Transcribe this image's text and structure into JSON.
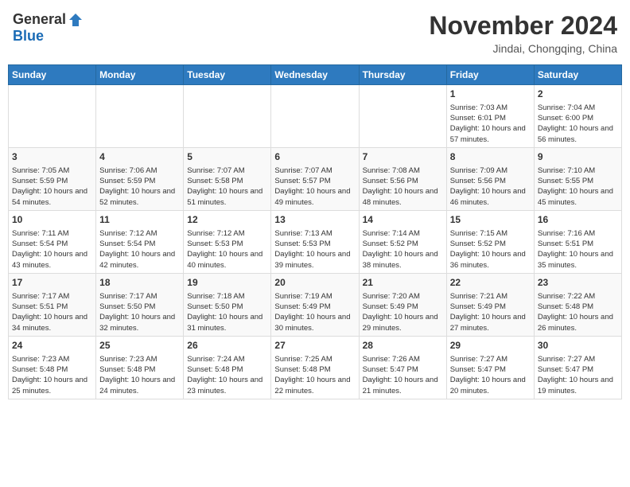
{
  "header": {
    "logo_general": "General",
    "logo_blue": "Blue",
    "month_title": "November 2024",
    "subtitle": "Jindai, Chongqing, China"
  },
  "calendar": {
    "days_of_week": [
      "Sunday",
      "Monday",
      "Tuesday",
      "Wednesday",
      "Thursday",
      "Friday",
      "Saturday"
    ],
    "weeks": [
      [
        {
          "day": "",
          "info": ""
        },
        {
          "day": "",
          "info": ""
        },
        {
          "day": "",
          "info": ""
        },
        {
          "day": "",
          "info": ""
        },
        {
          "day": "",
          "info": ""
        },
        {
          "day": "1",
          "info": "Sunrise: 7:03 AM\nSunset: 6:01 PM\nDaylight: 10 hours and 57 minutes."
        },
        {
          "day": "2",
          "info": "Sunrise: 7:04 AM\nSunset: 6:00 PM\nDaylight: 10 hours and 56 minutes."
        }
      ],
      [
        {
          "day": "3",
          "info": "Sunrise: 7:05 AM\nSunset: 5:59 PM\nDaylight: 10 hours and 54 minutes."
        },
        {
          "day": "4",
          "info": "Sunrise: 7:06 AM\nSunset: 5:59 PM\nDaylight: 10 hours and 52 minutes."
        },
        {
          "day": "5",
          "info": "Sunrise: 7:07 AM\nSunset: 5:58 PM\nDaylight: 10 hours and 51 minutes."
        },
        {
          "day": "6",
          "info": "Sunrise: 7:07 AM\nSunset: 5:57 PM\nDaylight: 10 hours and 49 minutes."
        },
        {
          "day": "7",
          "info": "Sunrise: 7:08 AM\nSunset: 5:56 PM\nDaylight: 10 hours and 48 minutes."
        },
        {
          "day": "8",
          "info": "Sunrise: 7:09 AM\nSunset: 5:56 PM\nDaylight: 10 hours and 46 minutes."
        },
        {
          "day": "9",
          "info": "Sunrise: 7:10 AM\nSunset: 5:55 PM\nDaylight: 10 hours and 45 minutes."
        }
      ],
      [
        {
          "day": "10",
          "info": "Sunrise: 7:11 AM\nSunset: 5:54 PM\nDaylight: 10 hours and 43 minutes."
        },
        {
          "day": "11",
          "info": "Sunrise: 7:12 AM\nSunset: 5:54 PM\nDaylight: 10 hours and 42 minutes."
        },
        {
          "day": "12",
          "info": "Sunrise: 7:12 AM\nSunset: 5:53 PM\nDaylight: 10 hours and 40 minutes."
        },
        {
          "day": "13",
          "info": "Sunrise: 7:13 AM\nSunset: 5:53 PM\nDaylight: 10 hours and 39 minutes."
        },
        {
          "day": "14",
          "info": "Sunrise: 7:14 AM\nSunset: 5:52 PM\nDaylight: 10 hours and 38 minutes."
        },
        {
          "day": "15",
          "info": "Sunrise: 7:15 AM\nSunset: 5:52 PM\nDaylight: 10 hours and 36 minutes."
        },
        {
          "day": "16",
          "info": "Sunrise: 7:16 AM\nSunset: 5:51 PM\nDaylight: 10 hours and 35 minutes."
        }
      ],
      [
        {
          "day": "17",
          "info": "Sunrise: 7:17 AM\nSunset: 5:51 PM\nDaylight: 10 hours and 34 minutes."
        },
        {
          "day": "18",
          "info": "Sunrise: 7:17 AM\nSunset: 5:50 PM\nDaylight: 10 hours and 32 minutes."
        },
        {
          "day": "19",
          "info": "Sunrise: 7:18 AM\nSunset: 5:50 PM\nDaylight: 10 hours and 31 minutes."
        },
        {
          "day": "20",
          "info": "Sunrise: 7:19 AM\nSunset: 5:49 PM\nDaylight: 10 hours and 30 minutes."
        },
        {
          "day": "21",
          "info": "Sunrise: 7:20 AM\nSunset: 5:49 PM\nDaylight: 10 hours and 29 minutes."
        },
        {
          "day": "22",
          "info": "Sunrise: 7:21 AM\nSunset: 5:49 PM\nDaylight: 10 hours and 27 minutes."
        },
        {
          "day": "23",
          "info": "Sunrise: 7:22 AM\nSunset: 5:48 PM\nDaylight: 10 hours and 26 minutes."
        }
      ],
      [
        {
          "day": "24",
          "info": "Sunrise: 7:23 AM\nSunset: 5:48 PM\nDaylight: 10 hours and 25 minutes."
        },
        {
          "day": "25",
          "info": "Sunrise: 7:23 AM\nSunset: 5:48 PM\nDaylight: 10 hours and 24 minutes."
        },
        {
          "day": "26",
          "info": "Sunrise: 7:24 AM\nSunset: 5:48 PM\nDaylight: 10 hours and 23 minutes."
        },
        {
          "day": "27",
          "info": "Sunrise: 7:25 AM\nSunset: 5:48 PM\nDaylight: 10 hours and 22 minutes."
        },
        {
          "day": "28",
          "info": "Sunrise: 7:26 AM\nSunset: 5:47 PM\nDaylight: 10 hours and 21 minutes."
        },
        {
          "day": "29",
          "info": "Sunrise: 7:27 AM\nSunset: 5:47 PM\nDaylight: 10 hours and 20 minutes."
        },
        {
          "day": "30",
          "info": "Sunrise: 7:27 AM\nSunset: 5:47 PM\nDaylight: 10 hours and 19 minutes."
        }
      ]
    ]
  }
}
